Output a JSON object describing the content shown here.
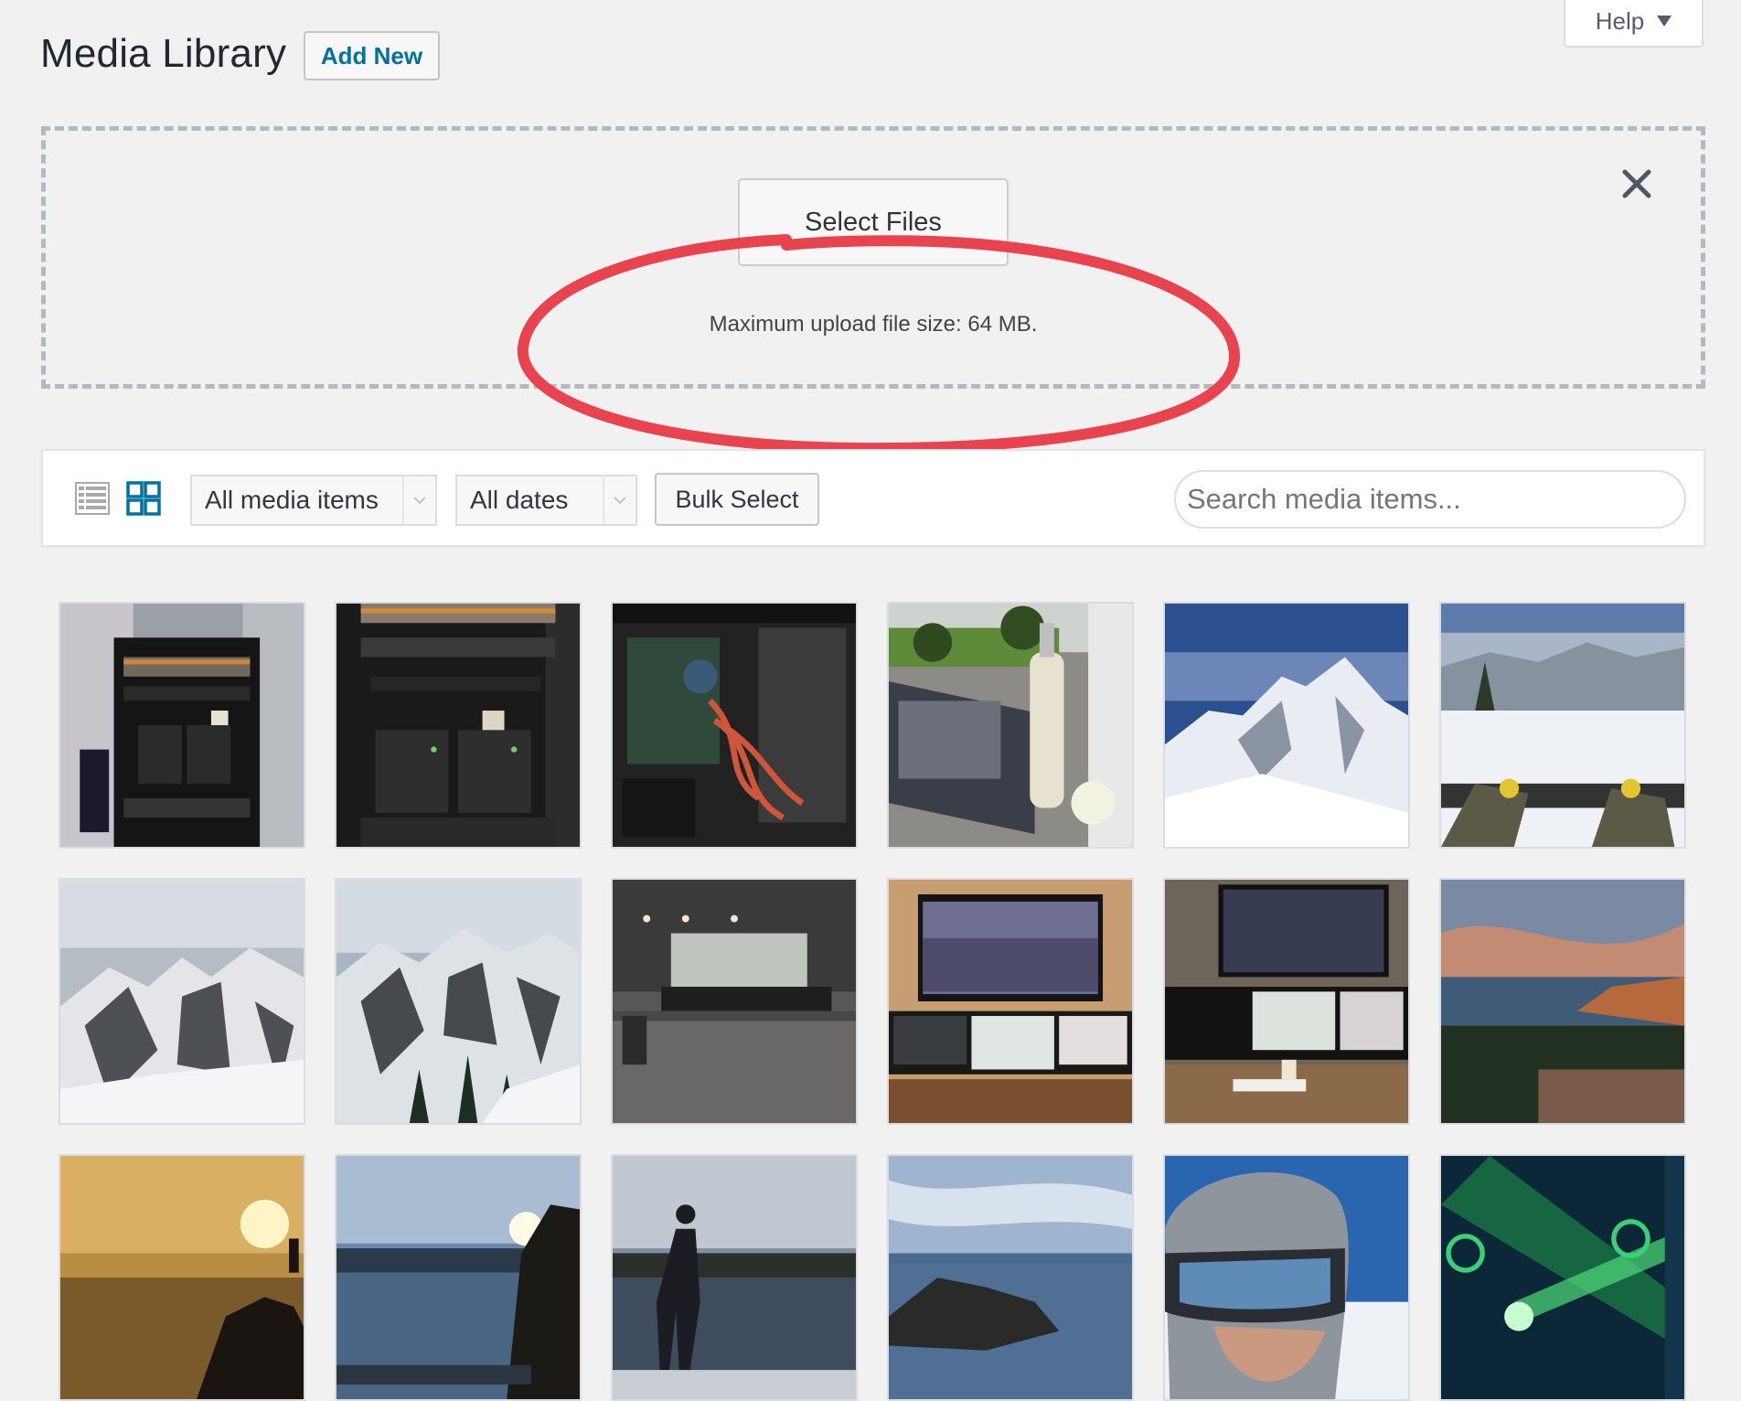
{
  "header": {
    "title": "Media Library",
    "add_new_label": "Add New",
    "help_label": "Help"
  },
  "uploader": {
    "select_files_label": "Select Files",
    "max_upload_text": "Maximum upload file size: 64 MB.",
    "annotation_color": "#e8434e"
  },
  "toolbar": {
    "filter_type_value": "All media items",
    "filter_date_value": "All dates",
    "bulk_select_label": "Bulk Select",
    "search_placeholder": "Search media items..."
  },
  "colors": {
    "accent": "#0071a1",
    "background": "#f1f1f1"
  },
  "media_items": [
    {
      "subject": "server-rack-with-nas"
    },
    {
      "subject": "server-rack-closeup"
    },
    {
      "subject": "open-pc-case-cables"
    },
    {
      "subject": "laptop-and-wine-on-patio"
    },
    {
      "subject": "snowy-mountain-peak-blue-sky"
    },
    {
      "subject": "snowboard-on-mountain-summit"
    },
    {
      "subject": "snowy-mountain-range"
    },
    {
      "subject": "snowy-valley-with-trees"
    },
    {
      "subject": "spin-cycling-studio"
    },
    {
      "subject": "tv-above-desk-monitors"
    },
    {
      "subject": "desk-with-multiple-monitors"
    },
    {
      "subject": "coastal-sunset-cliffs"
    },
    {
      "subject": "golden-sunset-silhouette"
    },
    {
      "subject": "rocky-coast-sunburst"
    },
    {
      "subject": "person-on-beach-at-dusk"
    },
    {
      "subject": "rocky-shore-blue-sky"
    },
    {
      "subject": "skier-helmet-goggles-selfie"
    },
    {
      "subject": "green-laser-show-logo"
    }
  ]
}
